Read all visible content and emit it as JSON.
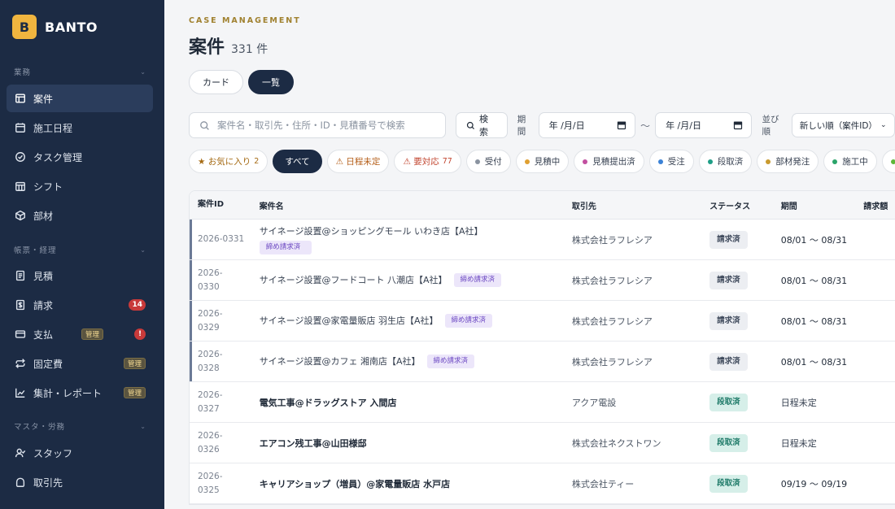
{
  "brand": {
    "logo_letter": "B",
    "name": "BANTO"
  },
  "sidebar": {
    "sections": [
      {
        "label": "業務"
      },
      {
        "label": "帳票・経理"
      },
      {
        "label": "マスタ・労務"
      }
    ],
    "items": [
      {
        "label": "案件",
        "icon": "table-icon"
      },
      {
        "label": "施工日程",
        "icon": "calendar-icon"
      },
      {
        "label": "タスク管理",
        "icon": "check-circle-icon"
      },
      {
        "label": "シフト",
        "icon": "grid-calendar-icon"
      },
      {
        "label": "部材",
        "icon": "box-icon"
      },
      {
        "label": "見積",
        "icon": "document-icon"
      },
      {
        "label": "請求",
        "icon": "invoice-icon",
        "badge": "14"
      },
      {
        "label": "支払",
        "icon": "credit-card-icon",
        "badge_mgmt": "管理",
        "badge": "!"
      },
      {
        "label": "固定費",
        "icon": "repeat-icon",
        "badge_mgmt": "管理"
      },
      {
        "label": "集計・レポート",
        "icon": "chart-icon",
        "badge_mgmt": "管理"
      },
      {
        "label": "スタッフ",
        "icon": "user-icon"
      },
      {
        "label": "取引先",
        "icon": "handshake-icon"
      }
    ]
  },
  "header": {
    "eyebrow": "CASE MANAGEMENT",
    "title": "案件",
    "count": "331 件"
  },
  "view_toggle": {
    "card": "カード",
    "list": "一覧"
  },
  "filters": {
    "search_placeholder": "案件名・取引先・住所・ID・見積番号で検索",
    "search_button": "検索",
    "period_label": "期間",
    "date_from": "年 /月/日",
    "date_to": "年 /月/日",
    "range_sep": "〜",
    "sort_label": "並び順",
    "sort_value": "新しい順（案件ID）"
  },
  "chips": {
    "favorite": {
      "label": "★ お気に入り",
      "count": "2"
    },
    "all": "すべて",
    "unscheduled": "⚠ 日程未定",
    "action_required": {
      "label": "⚠ 要対応",
      "count": "77"
    },
    "statuses": [
      {
        "label": "受付",
        "color": "#8a93a0"
      },
      {
        "label": "見積中",
        "color": "#e0a030"
      },
      {
        "label": "見積提出済",
        "color": "#c24fa0"
      },
      {
        "label": "受注",
        "color": "#3b82d6"
      },
      {
        "label": "段取済",
        "color": "#1e9e86"
      },
      {
        "label": "部材発注",
        "color": "#c99a2e"
      },
      {
        "label": "施工中",
        "color": "#2aa46a"
      },
      {
        "label": "",
        "color": "#5fb83a"
      }
    ]
  },
  "table": {
    "columns": [
      "案件ID",
      "案件名",
      "取引先",
      "ステータス",
      "期間",
      "請求額"
    ],
    "rows": [
      {
        "id": "2026-0331",
        "name": "サイネージ設置@ショッピングモール いわき店【A社】",
        "tag": "締め請求済",
        "client": "株式会社ラフレシア",
        "status": "請求済",
        "period": "08/01 〜 08/31"
      },
      {
        "id_line1": "2026-",
        "id_line2": "0330",
        "name": "サイネージ設置@フードコート 八潮店【A社】",
        "tag": "締め請求済",
        "client": "株式会社ラフレシア",
        "status": "請求済",
        "period": "08/01 〜 08/31"
      },
      {
        "id_line1": "2026-",
        "id_line2": "0329",
        "name": "サイネージ設置@家電量販店 羽生店【A社】",
        "tag": "締め請求済",
        "client": "株式会社ラフレシア",
        "status": "請求済",
        "period": "08/01 〜 08/31"
      },
      {
        "id_line1": "2026-",
        "id_line2": "0328",
        "name": "サイネージ設置@カフェ 湘南店【A社】",
        "tag": "締め請求済",
        "client": "株式会社ラフレシア",
        "status": "請求済",
        "period": "08/01 〜 08/31"
      },
      {
        "id_line1": "2026-",
        "id_line2": "0327",
        "name": "電気工事@ドラッグストア 入間店",
        "client": "アクア電設",
        "status": "段取済",
        "period": "日程未定"
      },
      {
        "id_line1": "2026-",
        "id_line2": "0326",
        "name": "エアコン残工事@山田様邸",
        "client": "株式会社ネクストワン",
        "status": "段取済",
        "period": "日程未定"
      },
      {
        "id_line1": "2026-",
        "id_line2": "0325",
        "name": "キャリアショップ（増員）@家電量販店 水戸店",
        "client": "株式会社ティー",
        "status": "段取済",
        "period": "09/19 〜 09/19"
      }
    ]
  }
}
